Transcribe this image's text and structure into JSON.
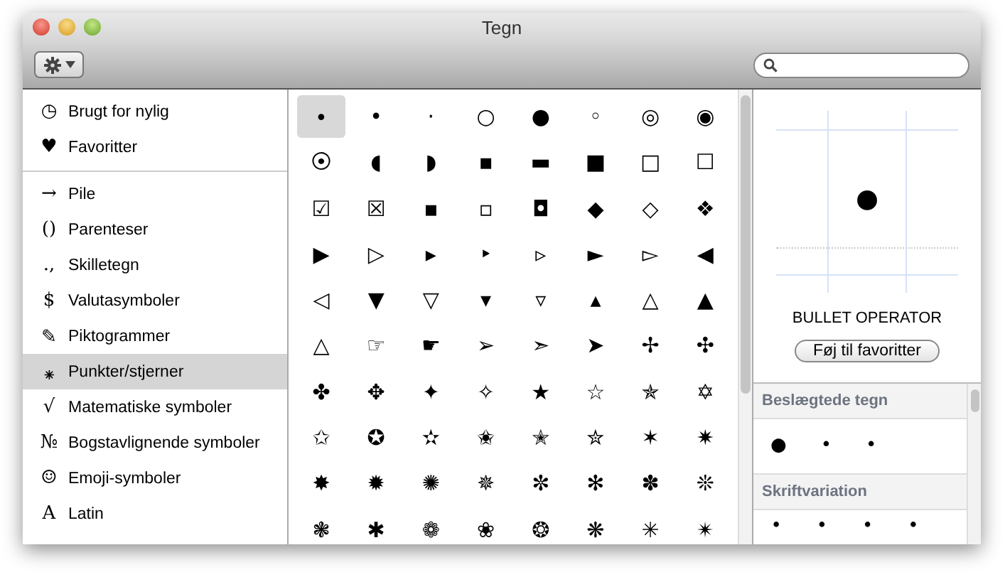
{
  "window": {
    "title": "Tegn"
  },
  "sidebar": {
    "groups": [
      [
        {
          "icon": "◷",
          "label": "Brugt for nylig",
          "selected": false
        },
        {
          "icon": "♥",
          "label": "Favoritter",
          "selected": false
        }
      ],
      [
        {
          "icon": "→",
          "label": "Pile",
          "selected": false
        },
        {
          "icon": "()",
          "label": "Parenteser",
          "selected": false
        },
        {
          "icon": ".,",
          "label": "Skilletegn",
          "selected": false
        },
        {
          "icon": "$",
          "label": "Valutasymboler",
          "selected": false
        },
        {
          "icon": "✎",
          "label": "Piktogrammer",
          "selected": false
        },
        {
          "icon": "⁕",
          "label": "Punkter/stjerner",
          "selected": true
        },
        {
          "icon": "√",
          "label": "Matematiske symboler",
          "selected": false
        },
        {
          "icon": "№",
          "label": "Bogstavlignende symboler",
          "selected": false
        },
        {
          "icon": "☺",
          "label": "Emoji-symboler",
          "selected": false
        },
        {
          "icon": "A",
          "label": "Latin",
          "selected": false
        }
      ]
    ]
  },
  "characters": [
    {
      "char": "∙",
      "selected": true
    },
    {
      "char": "•",
      "selected": false
    },
    {
      "char": "·",
      "selected": false
    },
    {
      "char": "○",
      "selected": false
    },
    {
      "char": "●",
      "selected": false
    },
    {
      "char": "◦",
      "selected": false
    },
    {
      "char": "◎",
      "selected": false
    },
    {
      "char": "◉",
      "selected": false
    },
    {
      "char": "⦿",
      "selected": false
    },
    {
      "char": "◖",
      "selected": false
    },
    {
      "char": "◗",
      "selected": false
    },
    {
      "char": "▪",
      "selected": false
    },
    {
      "char": "▬",
      "selected": false
    },
    {
      "char": "■",
      "selected": false
    },
    {
      "char": "□",
      "selected": false
    },
    {
      "char": "☐",
      "selected": false
    },
    {
      "char": "☑",
      "selected": false
    },
    {
      "char": "☒",
      "selected": false
    },
    {
      "char": "▪",
      "selected": false
    },
    {
      "char": "▫",
      "selected": false
    },
    {
      "char": "◘",
      "selected": false
    },
    {
      "char": "◆",
      "selected": false
    },
    {
      "char": "◇",
      "selected": false
    },
    {
      "char": "❖",
      "selected": false
    },
    {
      "char": "▶",
      "selected": false
    },
    {
      "char": "▷",
      "selected": false
    },
    {
      "char": "▸",
      "selected": false
    },
    {
      "char": "‣",
      "selected": false
    },
    {
      "char": "▹",
      "selected": false
    },
    {
      "char": "►",
      "selected": false
    },
    {
      "char": "▻",
      "selected": false
    },
    {
      "char": "◀",
      "selected": false
    },
    {
      "char": "◁",
      "selected": false
    },
    {
      "char": "▼",
      "selected": false
    },
    {
      "char": "▽",
      "selected": false
    },
    {
      "char": "▾",
      "selected": false
    },
    {
      "char": "▿",
      "selected": false
    },
    {
      "char": "▴",
      "selected": false
    },
    {
      "char": "△",
      "selected": false
    },
    {
      "char": "▲",
      "selected": false
    },
    {
      "char": "△",
      "selected": false
    },
    {
      "char": "☞",
      "selected": false
    },
    {
      "char": "☛",
      "selected": false
    },
    {
      "char": "➢",
      "selected": false
    },
    {
      "char": "➣",
      "selected": false
    },
    {
      "char": "➤",
      "selected": false
    },
    {
      "char": "✢",
      "selected": false
    },
    {
      "char": "✣",
      "selected": false
    },
    {
      "char": "✤",
      "selected": false
    },
    {
      "char": "✥",
      "selected": false
    },
    {
      "char": "✦",
      "selected": false
    },
    {
      "char": "✧",
      "selected": false
    },
    {
      "char": "★",
      "selected": false
    },
    {
      "char": "☆",
      "selected": false
    },
    {
      "char": "✯",
      "selected": false
    },
    {
      "char": "✡",
      "selected": false
    },
    {
      "char": "✩",
      "selected": false
    },
    {
      "char": "✪",
      "selected": false
    },
    {
      "char": "✫",
      "selected": false
    },
    {
      "char": "✬",
      "selected": false
    },
    {
      "char": "✭",
      "selected": false
    },
    {
      "char": "✮",
      "selected": false
    },
    {
      "char": "✶",
      "selected": false
    },
    {
      "char": "✷",
      "selected": false
    },
    {
      "char": "✸",
      "selected": false
    },
    {
      "char": "✹",
      "selected": false
    },
    {
      "char": "✺",
      "selected": false
    },
    {
      "char": "✵",
      "selected": false
    },
    {
      "char": "✼",
      "selected": false
    },
    {
      "char": "✻",
      "selected": false
    },
    {
      "char": "✽",
      "selected": false
    },
    {
      "char": "❊",
      "selected": false
    },
    {
      "char": "❃",
      "selected": false
    },
    {
      "char": "✱",
      "selected": false
    },
    {
      "char": "❁",
      "selected": false
    },
    {
      "char": "❀",
      "selected": false
    },
    {
      "char": "❂",
      "selected": false
    },
    {
      "char": "❋",
      "selected": false
    },
    {
      "char": "✳",
      "selected": false
    },
    {
      "char": "✴",
      "selected": false
    }
  ],
  "preview": {
    "glyph": "∙",
    "name": "BULLET OPERATOR",
    "button": "Føj til favoritter"
  },
  "sections": [
    {
      "title": "Beslægtede tegn",
      "chars": [
        "●",
        "•",
        "•"
      ]
    },
    {
      "title": "Skriftvariation",
      "chars": [
        "∙",
        "∙",
        "∙",
        "∙"
      ]
    }
  ]
}
